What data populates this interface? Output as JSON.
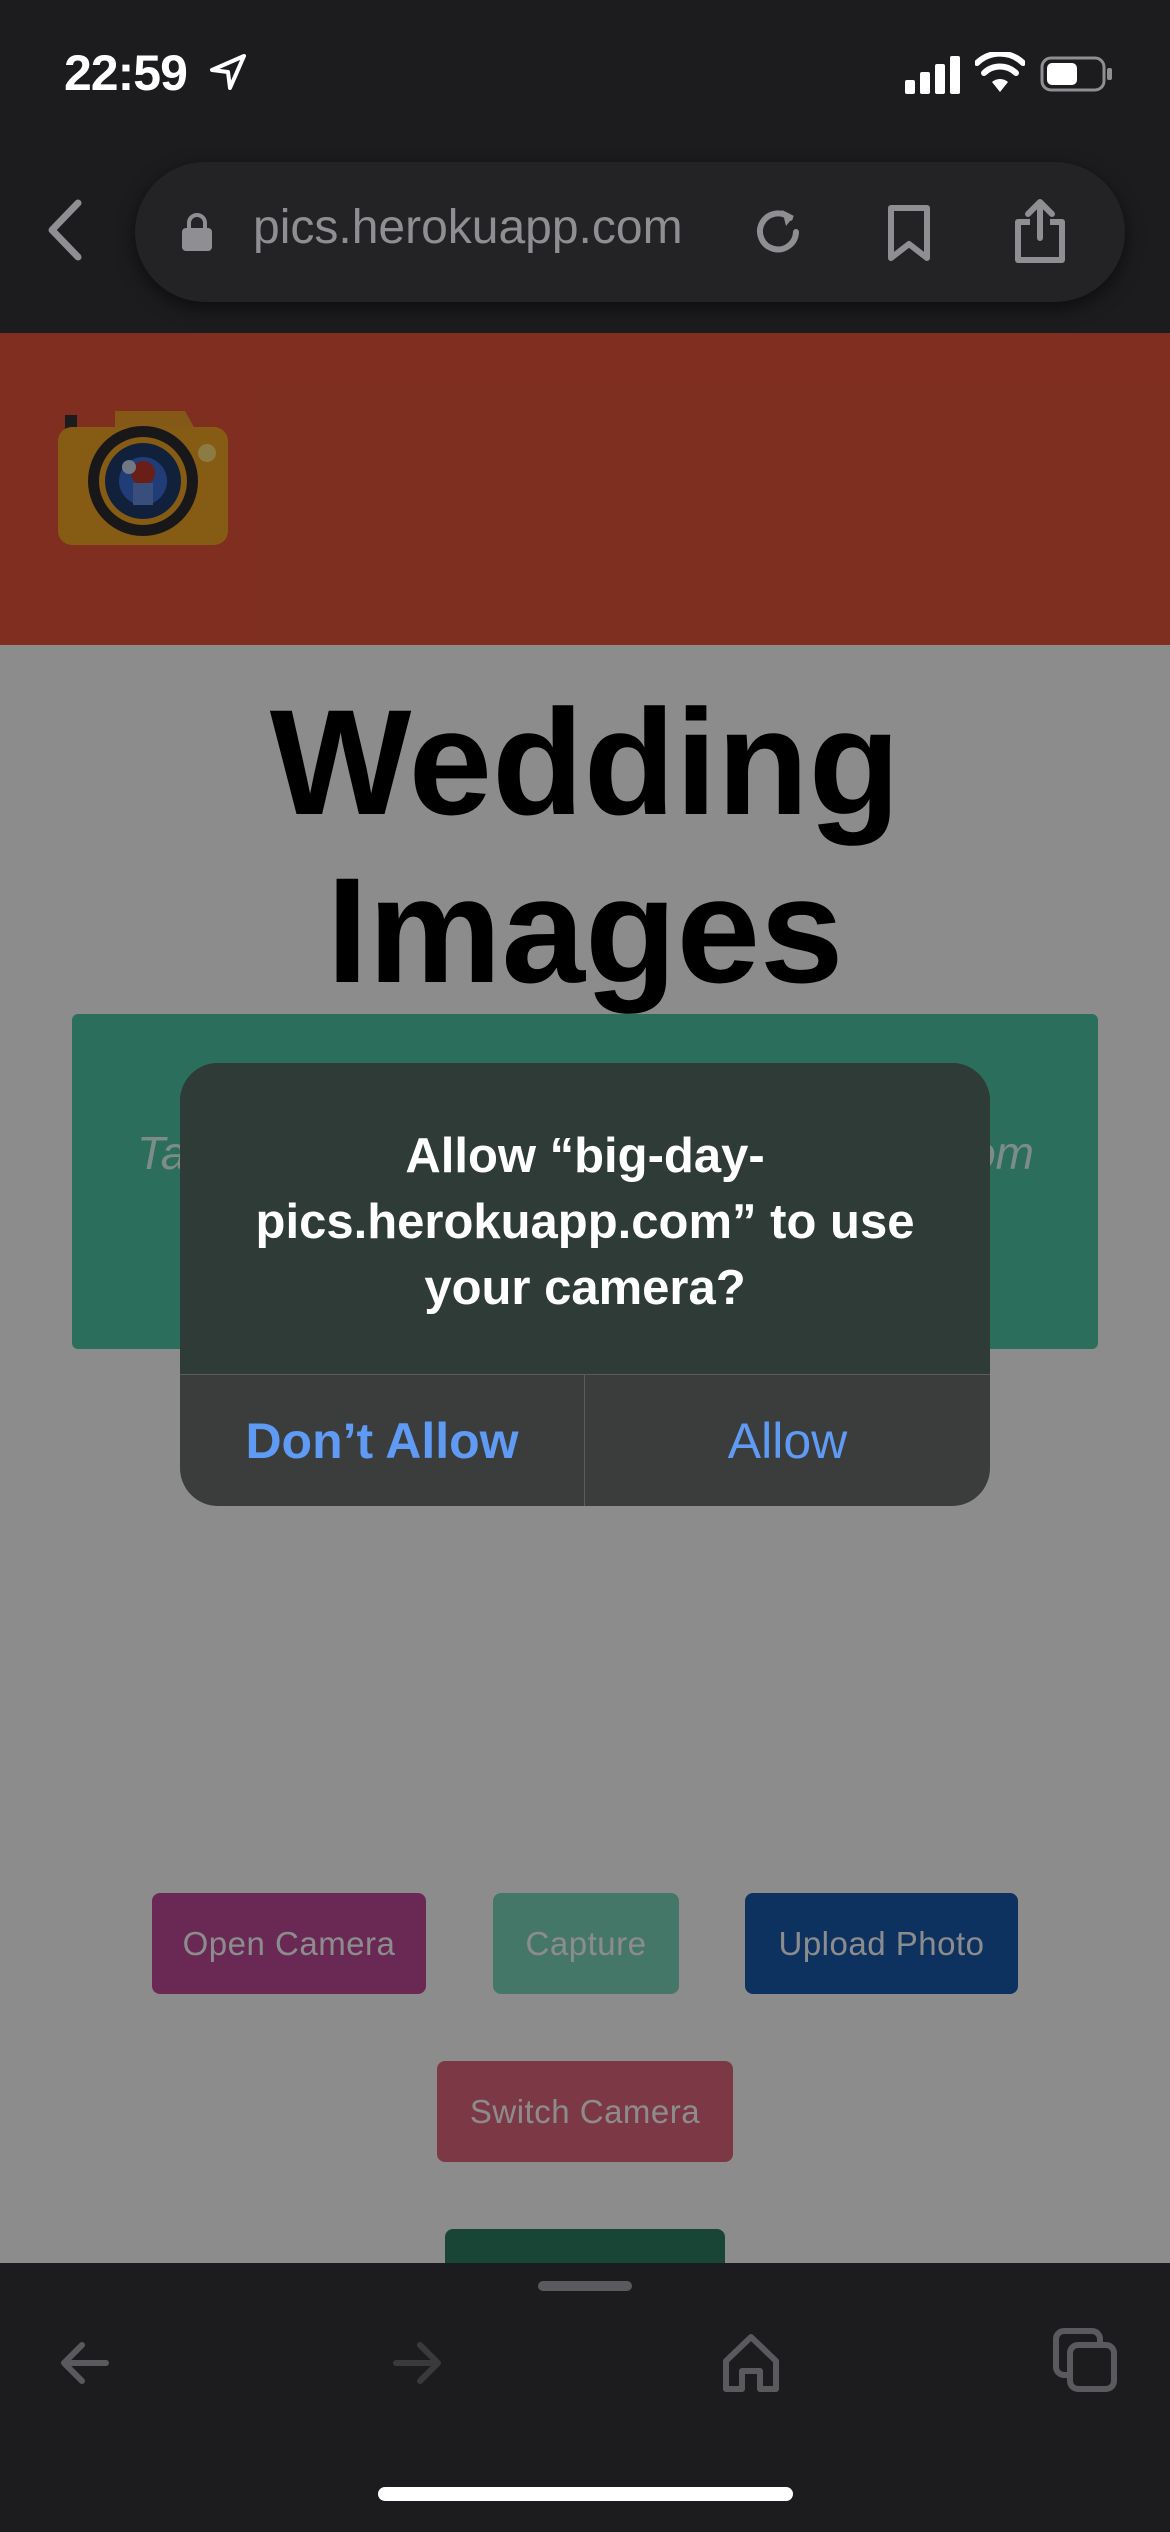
{
  "status_bar": {
    "time": "22:59",
    "icons": [
      "location-arrow-icon",
      "cellular-signal-icon",
      "wifi-icon",
      "battery-icon"
    ]
  },
  "browser": {
    "url": "pics.herokuapp.com"
  },
  "page": {
    "title_line1": "Wedding",
    "title_line2": "Images",
    "info_left_fragment": "Ta",
    "info_right_fragment": "om",
    "buttons": {
      "open_camera": "Open Camera",
      "capture": "Capture",
      "upload_photo": "Upload Photo",
      "switch_camera": "Switch Camera"
    }
  },
  "dialog": {
    "message": "Allow “big-day-pics.herokuapp.com” to use your camera?",
    "dont_allow": "Don’t Allow",
    "allow": "Allow"
  },
  "colors": {
    "header": "#e8553b",
    "info_box": "#4fc9a7",
    "dialog_button_text": "#5f9af5"
  }
}
